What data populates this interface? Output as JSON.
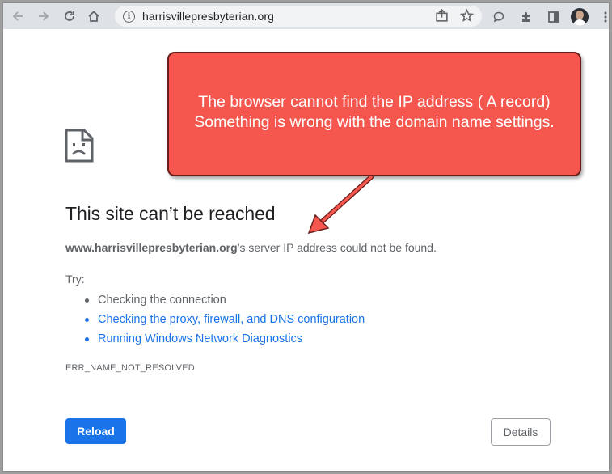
{
  "browser": {
    "url": "harrisvillepresbyterian.org"
  },
  "error_page": {
    "title": "This site can’t be reached",
    "domain": "www.harrisvillepresbyterian.org",
    "description_suffix": "’s server IP address could not be found.",
    "try_label": "Try:",
    "suggestions": [
      {
        "label": "Checking the connection",
        "is_link": false
      },
      {
        "label": "Checking the proxy, firewall, and DNS configuration",
        "is_link": true
      },
      {
        "label": "Running Windows Network Diagnostics",
        "is_link": true
      }
    ],
    "error_code": "ERR_NAME_NOT_RESOLVED",
    "reload_label": "Reload",
    "details_label": "Details"
  },
  "annotation": {
    "line1": "The browser cannot find the IP address ( A record)",
    "line2": "Something is wrong with the domain name settings."
  },
  "colors": {
    "link": "#1a73e8",
    "primary_button": "#1a73e8",
    "callout_fill": "#f5574e",
    "arrow": "#f5574e"
  },
  "icons": [
    "back-arrow-icon",
    "forward-arrow-icon",
    "reload-icon",
    "home-icon",
    "info-icon",
    "share-icon",
    "star-icon",
    "comment-icon",
    "extensions-icon",
    "sidebar-icon",
    "avatar",
    "kebab-menu-icon",
    "sad-page-icon"
  ]
}
